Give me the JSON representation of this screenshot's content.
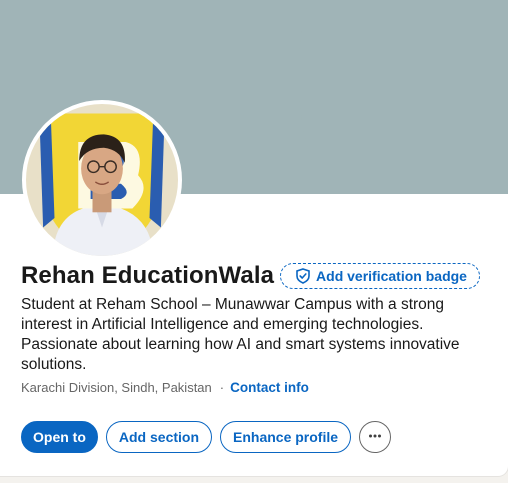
{
  "profile": {
    "name": "Rehan EducationWala",
    "verification_badge": {
      "label": "Add verification badge",
      "icon": "shield-check-icon"
    },
    "headline": "Student at Reham School – Munawwar Campus with a strong interest in Artificial Intelligence and emerging technologies. Passionate about learning how AI and smart systems innovative solutions.",
    "location": "Karachi Division, Sindh, Pakistan",
    "separator": "·",
    "contact_info_label": "Contact info"
  },
  "actions": {
    "open_to": "Open to",
    "add_section": "Add section",
    "enhance_profile": "Enhance profile",
    "more_icon": "ellipsis-icon",
    "more_label": "···"
  },
  "colors": {
    "brand": "#0a66c2",
    "banner": "#a0b4b7",
    "text": "#191919",
    "muted": "#666666"
  }
}
